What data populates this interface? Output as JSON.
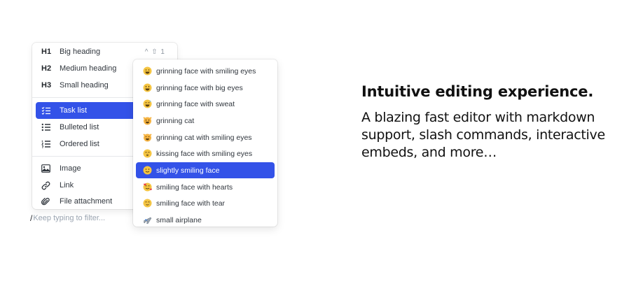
{
  "block_menu": {
    "headings": [
      {
        "tag": "H1",
        "label": "Big heading",
        "shortcut": "^ ⇧ 1"
      },
      {
        "tag": "H2",
        "label": "Medium heading"
      },
      {
        "tag": "H3",
        "label": "Small heading"
      }
    ],
    "lists": [
      {
        "icon": "checklist-icon",
        "label": "Task list",
        "active": true
      },
      {
        "icon": "bulleted-list-icon",
        "label": "Bulleted list"
      },
      {
        "icon": "ordered-list-icon",
        "label": "Ordered list"
      }
    ],
    "media": [
      {
        "icon": "image-icon",
        "label": "Image"
      },
      {
        "icon": "link-icon",
        "label": "Link"
      },
      {
        "icon": "paperclip-icon",
        "label": "File attachment"
      }
    ]
  },
  "emoji_menu": {
    "items": [
      {
        "emoji": "😀",
        "label": "grinning face with smiling eyes"
      },
      {
        "emoji": "😃",
        "label": "grinning face with big eyes"
      },
      {
        "emoji": "😅",
        "label": "grinning face with sweat"
      },
      {
        "emoji": "😺",
        "label": "grinning cat"
      },
      {
        "emoji": "😸",
        "label": "grinning cat with smiling eyes"
      },
      {
        "emoji": "😙",
        "label": "kissing face with smiling eyes"
      },
      {
        "emoji": "🙂",
        "label": "slightly smiling face",
        "active": true
      },
      {
        "emoji": "🥰",
        "label": "smiling face with hearts"
      },
      {
        "emoji": "🥲",
        "label": "smiling face with tear"
      },
      {
        "emoji": "🛩",
        "label": "small airplane"
      }
    ]
  },
  "filter": {
    "slash": "/",
    "placeholder": "Keep typing to filter..."
  },
  "marketing": {
    "headline": "Intuitive editing experience.",
    "subcopy": "A blazing fast editor with markdown support, slash commands, interactive embeds, and more…"
  },
  "colors": {
    "accent": "#3352e8",
    "emoji_yellow": "#f5c542"
  }
}
